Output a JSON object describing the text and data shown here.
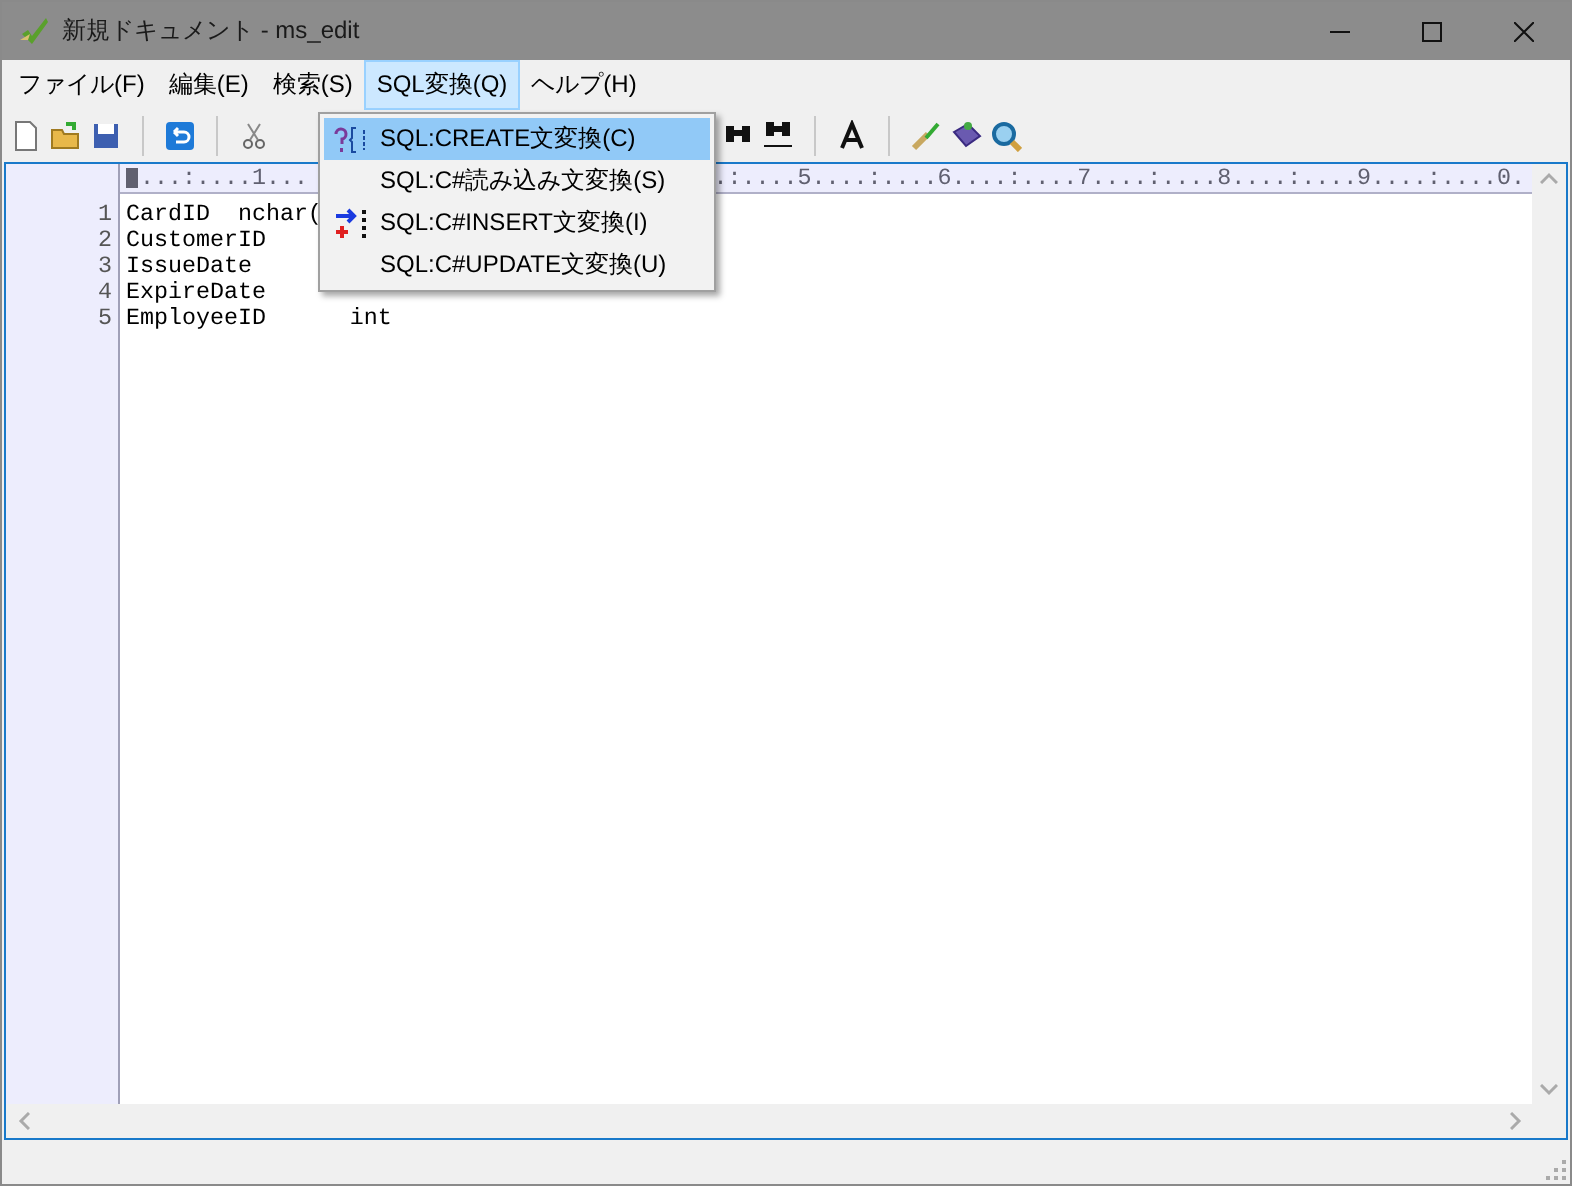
{
  "window": {
    "title": "新規ドキュメント - ms_edit"
  },
  "menu_bar": [
    {
      "label": "ファイル(F)",
      "selected": false
    },
    {
      "label": "編集(E)",
      "selected": false
    },
    {
      "label": "検索(S)",
      "selected": false
    },
    {
      "label": "SQL変換(Q)",
      "selected": true
    },
    {
      "label": "ヘルプ(H)",
      "selected": false
    }
  ],
  "dropdown": [
    {
      "label": "SQL:CREATE文変換(C)",
      "selected": true
    },
    {
      "label": "SQL:C#読み込み文変換(S)",
      "selected": false
    },
    {
      "label": "SQL:C#INSERT文変換(I)",
      "selected": false
    },
    {
      "label": "SQL:C#UPDATE文変換(U)",
      "selected": false
    }
  ],
  "editor": {
    "ruler_left": "...:....1...",
    "ruler_right": ".:....5....:....6....:....7....:....8....:....9....:....0.",
    "lines": [
      {
        "number": "1",
        "text": "CardID  nchar("
      },
      {
        "number": "2",
        "text": "CustomerID"
      },
      {
        "number": "3",
        "text": "IssueDate"
      },
      {
        "number": "4",
        "text": "ExpireDate"
      },
      {
        "number": "5",
        "text": "EmployeeID      int"
      }
    ]
  }
}
